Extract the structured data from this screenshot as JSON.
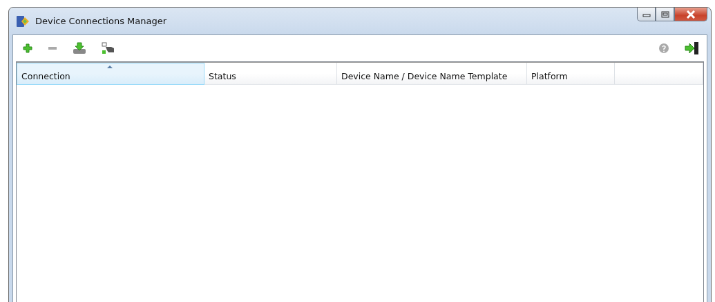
{
  "window": {
    "title": "Device Connections Manager"
  },
  "table": {
    "columns": [
      {
        "label": "Connection",
        "sorted": true
      },
      {
        "label": "Status",
        "sorted": false
      },
      {
        "label": "Device Name / Device Name Template",
        "sorted": false
      },
      {
        "label": "Platform",
        "sorted": false
      }
    ]
  }
}
